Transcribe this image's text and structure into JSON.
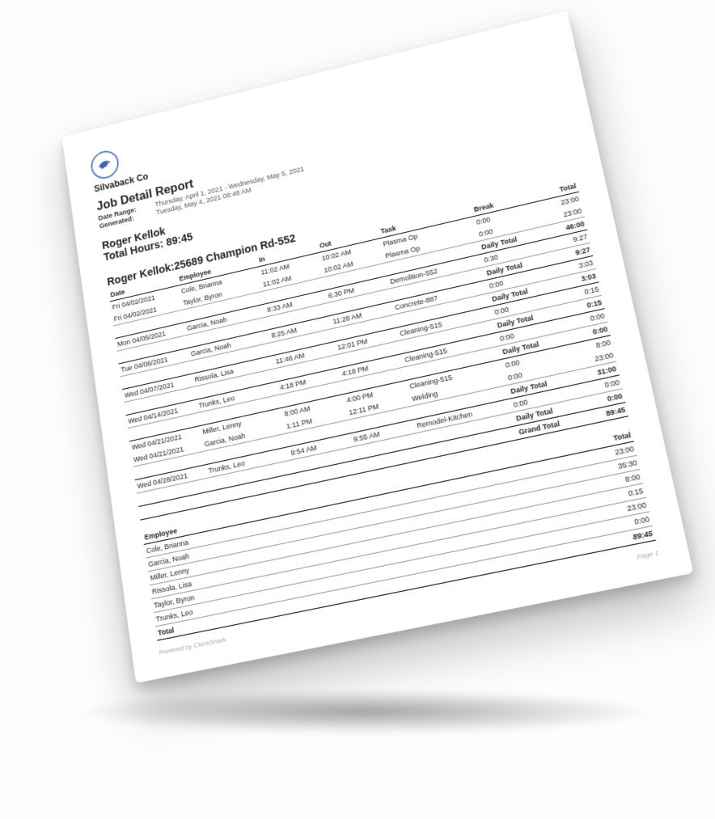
{
  "company": "Silvaback Co",
  "report_title": "Job Detail Report",
  "meta": {
    "date_range_label": "Date Range:",
    "date_range_value": "Thursday, April 1, 2021 - Wednesday, May 5, 2021",
    "generated_label": "Generated:",
    "generated_value": "Tuesday, May 4, 2021 08:48 AM"
  },
  "person": {
    "name_line": "Roger Kellok",
    "total_label": "Total Hours:",
    "total_value": "89:45"
  },
  "section_title": "Roger Kellok:25689 Champion Rd-552",
  "columns": {
    "date": "Date",
    "employee": "Employee",
    "in": "In",
    "out": "Out",
    "task": "Task",
    "break": "Break",
    "total": "Total"
  },
  "daily_total_label": "Daily Total",
  "grand_total_label": "Grand Total",
  "rows": [
    {
      "type": "data",
      "date": "Fri 04/02/2021",
      "employee": "Cole, Brianna",
      "in": "11:02 AM",
      "out": "10:02 AM",
      "task": "Plasma Op",
      "break": "0:00",
      "total": "23:00"
    },
    {
      "type": "data",
      "date": "Fri 04/02/2021",
      "employee": "Taylor, Byron",
      "in": "11:02 AM",
      "out": "10:02 AM",
      "task": "Plasma Op",
      "break": "0:00",
      "total": "23:00"
    },
    {
      "type": "daily",
      "total": "46:00"
    },
    {
      "type": "data",
      "date": "Mon 04/05/2021",
      "employee": "Garcia, Noah",
      "in": "8:33 AM",
      "out": "6:30 PM",
      "task": "Demolition-552",
      "break": "0:30",
      "total": "9:27"
    },
    {
      "type": "daily",
      "total": "9:27"
    },
    {
      "type": "data",
      "date": "Tue 04/06/2021",
      "employee": "Garcia, Noah",
      "in": "8:25 AM",
      "out": "11:28 AM",
      "task": "Concrete-887",
      "break": "0:00",
      "total": "3:03"
    },
    {
      "type": "daily",
      "total": "3:03"
    },
    {
      "type": "data",
      "date": "Wed 04/07/2021",
      "employee": "Rissola, Lisa",
      "in": "11:46 AM",
      "out": "12:01 PM",
      "task": "Cleaning-515",
      "break": "0:00",
      "total": "0:15"
    },
    {
      "type": "daily",
      "total": "0:15"
    },
    {
      "type": "data",
      "date": "Wed 04/14/2021",
      "employee": "Trunks, Leo",
      "in": "4:18 PM",
      "out": "4:18 PM",
      "task": "Cleaning-515",
      "break": "0:00",
      "total": "0:00"
    },
    {
      "type": "daily",
      "total": "0:00"
    },
    {
      "type": "data",
      "date": "Wed 04/21/2021",
      "employee": "Miller, Lenny",
      "in": "8:00 AM",
      "out": "4:00 PM",
      "task": "Cleaning-515",
      "break": "0:00",
      "total": "8:00"
    },
    {
      "type": "data",
      "date": "Wed 04/21/2021",
      "employee": "Garcia, Noah",
      "in": "1:11 PM",
      "out": "12:11 PM",
      "task": "Welding",
      "break": "0:00",
      "total": "23:00"
    },
    {
      "type": "daily",
      "total": "31:00"
    },
    {
      "type": "data",
      "date": "Wed 04/28/2021",
      "employee": "Trunks, Leo",
      "in": "9:54 AM",
      "out": "9:55 AM",
      "task": "Remodel-Kitchen",
      "break": "0:00",
      "total": "0:00"
    },
    {
      "type": "daily",
      "total": "0:00"
    },
    {
      "type": "grand",
      "total": "89:45"
    }
  ],
  "summary_header": "Employee",
  "summary_total_header": "Total",
  "summary": [
    {
      "employee": "Cole, Brianna",
      "total": "23:00"
    },
    {
      "employee": "Garcia, Noah",
      "total": "35:30"
    },
    {
      "employee": "Miller, Lenny",
      "total": "8:00"
    },
    {
      "employee": "Rissola, Lisa",
      "total": "0:15"
    },
    {
      "employee": "Taylor, Byron",
      "total": "23:00"
    },
    {
      "employee": "Trunks, Leo",
      "total": "0:00"
    }
  ],
  "summary_total_label": "Total",
  "summary_total_value": "89:45",
  "footer": {
    "powered": "Powered by ClockShark",
    "page": "Page 1"
  }
}
